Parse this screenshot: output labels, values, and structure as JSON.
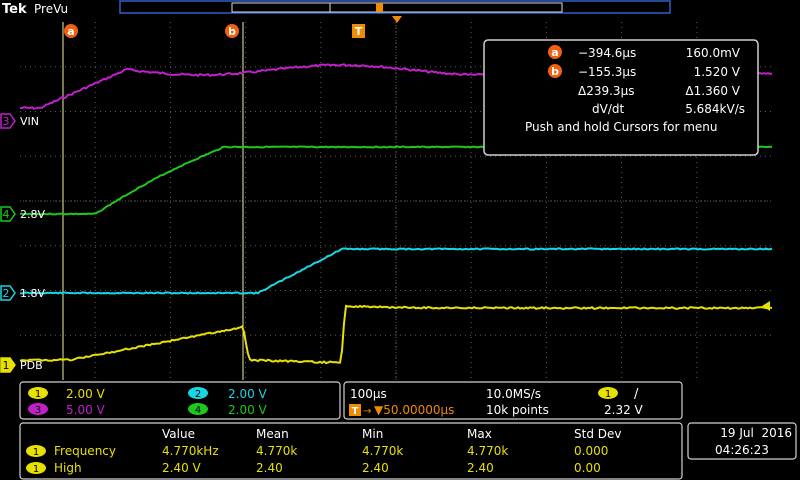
{
  "header": {
    "brand": "Tek",
    "mode": "PreVu",
    "cursor_a_marker": "a",
    "cursor_b_marker": "b",
    "trigger_marker": "T"
  },
  "channels": [
    {
      "id": "ch1",
      "number": "1",
      "label": "PDB",
      "color": "#e8e000",
      "scale": "2.00 V"
    },
    {
      "id": "ch2",
      "number": "2",
      "label": "1.8V",
      "color": "#19d6e3",
      "scale": "2.00 V"
    },
    {
      "id": "ch3",
      "number": "3",
      "label": "VIN",
      "color": "#c020c8",
      "scale": "5.00 V"
    },
    {
      "id": "ch4",
      "number": "4",
      "label": "2.8V",
      "color": "#1ec81e",
      "scale": "2.00 V"
    }
  ],
  "cursor_readout": {
    "a_time": "−394.6µs",
    "a_value": "160.0mV",
    "b_time": "−155.3µs",
    "b_value": "1.520 V",
    "delta_time": "Δ239.3µs",
    "delta_value": "Δ1.360 V",
    "dvdt_label": "dV/dt",
    "dvdt_value": "5.684kV/s",
    "hint": "Push and hold Cursors for menu"
  },
  "timebase": {
    "time_per_div": "100µs",
    "sample_rate": "10.0MS/s",
    "trigger_position": "▼50.00000µs",
    "record_length": "10k points",
    "trigger_channel": "1",
    "trigger_slope": "/",
    "trigger_level": "2.32 V"
  },
  "measurements": {
    "headers": [
      "Value",
      "Mean",
      "Min",
      "Max",
      "Std Dev"
    ],
    "rows": [
      {
        "channel": "1",
        "name": "Frequency",
        "values": [
          "4.770kHz",
          "4.770k",
          "4.770k",
          "4.770k",
          "0.000"
        ]
      },
      {
        "channel": "1",
        "name": "High",
        "values": [
          "2.40 V",
          "2.40",
          "2.40",
          "2.40",
          "0.00"
        ]
      }
    ]
  },
  "datetime": {
    "date": "19 Jul  2016",
    "time": "04:26:23"
  },
  "colors": {
    "cursor": "#f5f0a0",
    "grid": "#5a5a5a",
    "panel_border": "#cccccc",
    "header_bar": "#3060c8"
  }
}
